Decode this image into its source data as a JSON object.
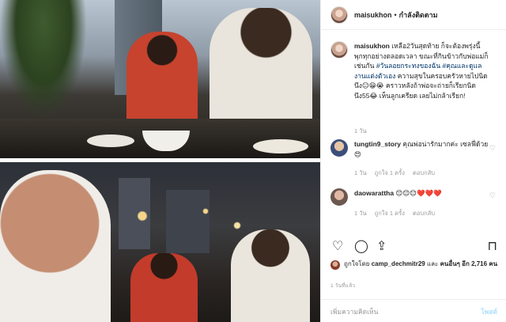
{
  "header": {
    "username": "maisukhon",
    "separator": "•",
    "follow_status": "กำลังติดตาม"
  },
  "caption": {
    "username": "maisukhon",
    "text_a": "เหลือ2วันสุดท้าย ก็จะต้องพรุ่งนี้พุกทุกอย่างตลอดเวลา ขณะที่กินข้าวกับพ่อแม่ก็เช่นกัน",
    "hashtag_1": "#วันลอยกระทงของฉัน",
    "hashtag_2": "#คุณและดูแลงานแต่งตัวเอง",
    "text_b": "ความสุขในครอบครัวหายไปนิดนึง😑😁😭 คราวหลังถ้าพ่อจะถ่ายก็เรียกนิดนึง55😂 เห็นลูกเครียด เลยไม่กล้าเรียก!",
    "time": "1 วัน"
  },
  "comments": [
    {
      "username": "tungtin9_story",
      "text": "คุณพ่อน่ารักมากค่ะ เซลฟี่ด้วย😍",
      "time": "1 วัน",
      "likes": "ถูกใจ 1 ครั้ง",
      "reply": "ตอบกลับ"
    },
    {
      "username": "daowarattha",
      "text": "😊😊😊❤️❤️❤️",
      "time": "1 วัน",
      "likes": "ถูกใจ 1 ครั้ง",
      "reply": "ตอบกลับ"
    }
  ],
  "actions": {
    "like_icon": "♡",
    "comment_icon": "◯",
    "share_icon": "⇪",
    "save_icon": "⊓"
  },
  "likes": {
    "prefix": "ถูกใจโดย",
    "user": "camp_dechmitr29",
    "and": "และ",
    "others_prefix": "คนอื่นๆ อีก",
    "count": "2,716",
    "suffix": "คน"
  },
  "post_time": "1 วันที่แล้ว",
  "add_comment": {
    "placeholder": "เพิ่มความคิดเห็น",
    "post_label": "โพสต์"
  }
}
